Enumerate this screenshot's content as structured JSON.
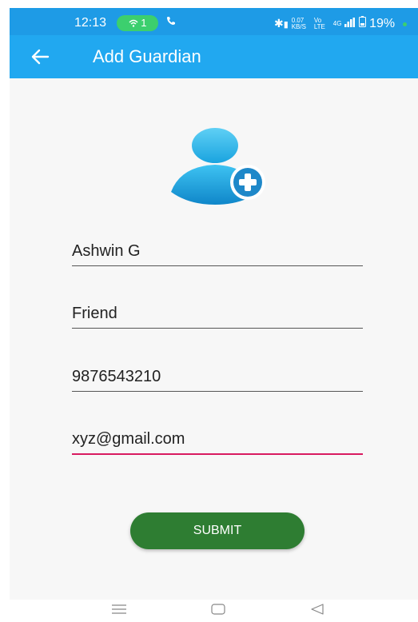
{
  "status_bar": {
    "time": "12:13",
    "wifi_badge": "1",
    "network_speed_top": "0.07",
    "network_speed_bottom": "KB/S",
    "volte_top": "Vo",
    "volte_bottom": "LTE",
    "network_type": "4G",
    "battery": "19%"
  },
  "app_bar": {
    "title": "Add Guardian",
    "back_icon": "arrow-left-icon"
  },
  "avatar_icon": "add-user-icon",
  "form": {
    "name_value": "Ashwin G",
    "relation_value": "Friend",
    "phone_value": "9876543210",
    "email_value": "xyz@gmail.com"
  },
  "submit_label": "SUBMIT",
  "nav_bar": {
    "menu_icon": "menu-icon",
    "home_icon": "home-icon",
    "back_icon": "back-triangle-icon"
  },
  "colors": {
    "status_bar": "#1e9be6",
    "app_bar": "#21a8f0",
    "submit": "#2e7d32",
    "active_underline": "#d81b60",
    "background": "#f7f7f7"
  }
}
